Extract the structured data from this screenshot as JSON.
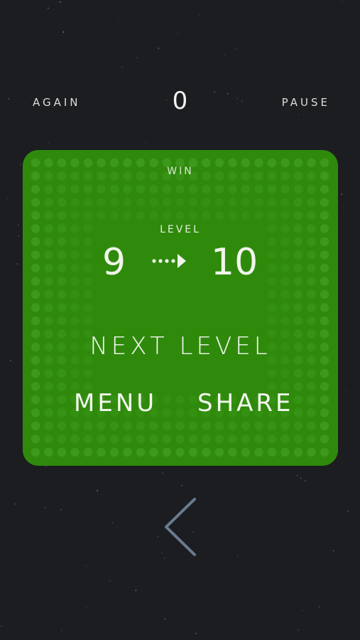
{
  "header": {
    "again_label": "AGAIN",
    "score": "0",
    "pause_label": "PAUSE"
  },
  "panel": {
    "status": "WIN",
    "level_label": "LEVEL",
    "level_from": "9",
    "level_to": "10",
    "next_level_label": "NEXT LEVEL",
    "menu_label": "MENU",
    "share_label": "SHARE",
    "arrow_icon": "dotted-arrow-right-icon"
  },
  "navigation": {
    "back_icon": "chevron-left-icon"
  },
  "colors": {
    "background": "#1c1d20",
    "panel": "#2f8a0c",
    "panel_dots": "#3e9a1e",
    "text": "#e9e9e9",
    "chevron": "#6a7b8e"
  }
}
